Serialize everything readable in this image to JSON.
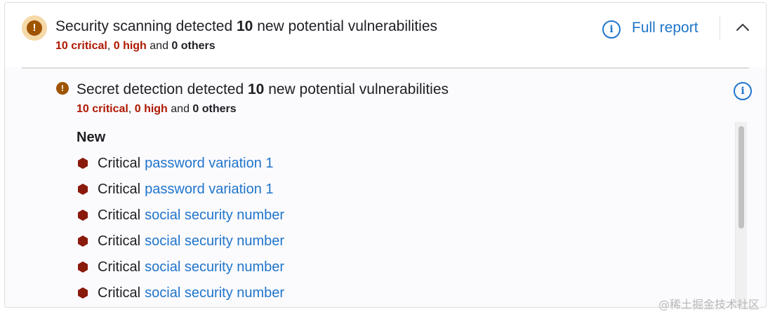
{
  "header": {
    "title_pre": "Security scanning detected ",
    "title_count": "10",
    "title_post": " new potential vulnerabilities",
    "critical": "10 critical",
    "sep1": ", ",
    "high": "0 high",
    "and": " and ",
    "others": "0 others",
    "full_report": "Full report"
  },
  "section": {
    "title_pre": "Secret detection detected ",
    "title_count": "10",
    "title_post": " new potential vulnerabilities",
    "critical": "10 critical",
    "sep1": ", ",
    "high": "0 high",
    "and": " and ",
    "others": "0 others",
    "new_heading": "New",
    "findings": [
      {
        "severity": "Critical",
        "name": "password variation 1"
      },
      {
        "severity": "Critical",
        "name": "password variation 1"
      },
      {
        "severity": "Critical",
        "name": "social security number"
      },
      {
        "severity": "Critical",
        "name": "social security number"
      },
      {
        "severity": "Critical",
        "name": "social security number"
      },
      {
        "severity": "Critical",
        "name": "social security number"
      }
    ]
  },
  "colors": {
    "critical": "#ae1800",
    "link": "#1f75cb",
    "warning": "#9e5400",
    "severity_hex": "#8a1a0c"
  },
  "watermark": "@稀土掘金技术社区"
}
